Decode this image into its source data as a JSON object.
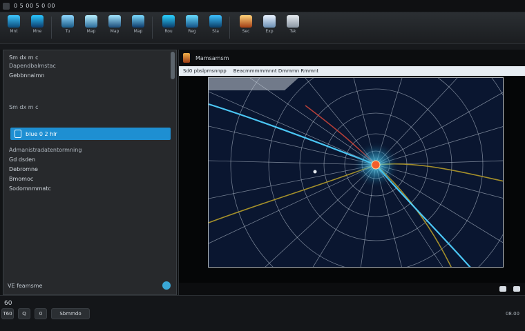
{
  "window": {
    "title": "0 5 00 5 0 00"
  },
  "ribbon": {
    "items": [
      {
        "label": "Mnt",
        "icon": "monitor-icon"
      },
      {
        "label": "Mne",
        "icon": "shield-icon"
      },
      {
        "label": "Tu",
        "icon": "cursor-icon"
      },
      {
        "label": "Map",
        "icon": "layers-icon"
      },
      {
        "label": "Map",
        "icon": "camera-icon"
      },
      {
        "label": "Map",
        "icon": "target-icon"
      },
      {
        "label": "Rou",
        "icon": "route-icon"
      },
      {
        "label": "Reg",
        "icon": "report-icon"
      },
      {
        "label": "Sta",
        "icon": "stats-icon"
      },
      {
        "label": "Sec",
        "icon": "settings-icon"
      },
      {
        "label": "Exp",
        "icon": "export-icon"
      },
      {
        "label": "Tsk",
        "icon": "task-icon"
      }
    ]
  },
  "left_panel": {
    "rows": [
      {
        "text": "Sm dx m c"
      },
      {
        "text": "Dapendbalmstac"
      },
      {
        "text": "Gebbnnaimn"
      },
      {
        "text": "Sm dx m c"
      },
      {
        "text": "Admanistradatentormning"
      },
      {
        "text": "Gd dsden"
      },
      {
        "text": "Debromne"
      },
      {
        "text": "Bmomoc"
      },
      {
        "text": "Sodomnmmatc"
      }
    ],
    "selected": "blue 0 2 hlr",
    "bottom_label": "VE feamsme"
  },
  "right_panel": {
    "header_title": "Mamsamsm",
    "address_fields": [
      "Sd0 pbslpmsnnpp",
      "Beacmmmmmnnt Dmmmn Rmmnt"
    ],
    "status": [
      "",
      ""
    ]
  },
  "bottombar": {
    "mini": "60",
    "tasks": [
      "T60",
      "Q",
      "0",
      "Sbmmdo"
    ],
    "clock": "08.00"
  },
  "colors": {
    "accent": "#1e8fd2",
    "canvas_bg": "#0a1630",
    "grid": "#b49c2a"
  }
}
